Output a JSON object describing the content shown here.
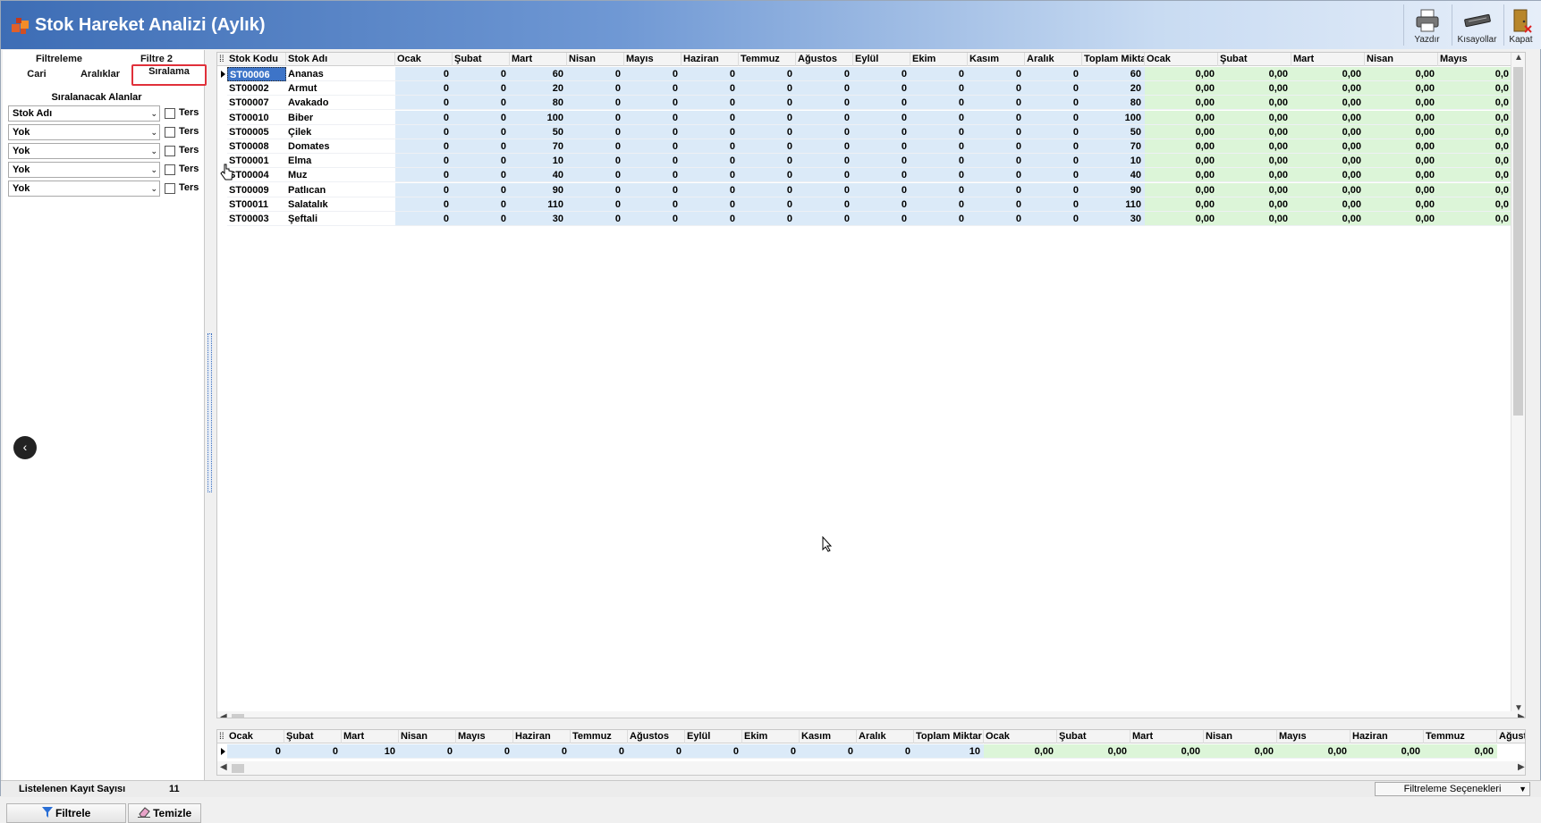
{
  "app": {
    "title": "Stok Hareket Analizi (Aylık)",
    "toolbar": {
      "print_label": "Yazdır",
      "shortcuts_label": "Kısayollar",
      "close_label": "Kapat"
    }
  },
  "left_panel": {
    "tabs_row1": [
      "Filtreleme",
      "Filtre 2"
    ],
    "tabs_row2": [
      "Cari",
      "Aralıklar",
      "Sıralama"
    ],
    "active_tab": "Sıralama",
    "section_title": "Sıralanacak Alanlar",
    "sort_fields": [
      {
        "value": "Stok Adı",
        "reverse_label": "Ters",
        "reverse": false
      },
      {
        "value": "Yok",
        "reverse_label": "Ters",
        "reverse": false
      },
      {
        "value": "Yok",
        "reverse_label": "Ters",
        "reverse": false
      },
      {
        "value": "Yok",
        "reverse_label": "Ters",
        "reverse": false
      },
      {
        "value": "Yok",
        "reverse_label": "Ters",
        "reverse": false
      }
    ],
    "filter_button": "Filtrele",
    "clear_button": "Temizle"
  },
  "grid": {
    "columns": [
      "Stok Kodu",
      "Stok Adı",
      "Ocak",
      "Şubat",
      "Mart",
      "Nisan",
      "Mayıs",
      "Haziran",
      "Temmuz",
      "Ağustos",
      "Eylül",
      "Ekim",
      "Kasım",
      "Aralık",
      "Toplam Miktar",
      "Ocak",
      "Şubat",
      "Mart",
      "Nisan",
      "Mayıs"
    ],
    "rows": [
      {
        "code": "ST00006",
        "name": "Ananas",
        "months": [
          "0",
          "0",
          "60",
          "0",
          "0",
          "0",
          "0",
          "0",
          "0",
          "0",
          "0",
          "0"
        ],
        "total": "60",
        "amounts": [
          "0,00",
          "0,00",
          "0,00",
          "0,00",
          "0,0"
        ]
      },
      {
        "code": "ST00002",
        "name": "Armut",
        "months": [
          "0",
          "0",
          "20",
          "0",
          "0",
          "0",
          "0",
          "0",
          "0",
          "0",
          "0",
          "0"
        ],
        "total": "20",
        "amounts": [
          "0,00",
          "0,00",
          "0,00",
          "0,00",
          "0,0"
        ]
      },
      {
        "code": "ST00007",
        "name": "Avakado",
        "months": [
          "0",
          "0",
          "80",
          "0",
          "0",
          "0",
          "0",
          "0",
          "0",
          "0",
          "0",
          "0"
        ],
        "total": "80",
        "amounts": [
          "0,00",
          "0,00",
          "0,00",
          "0,00",
          "0,0"
        ]
      },
      {
        "code": "ST00010",
        "name": "Biber",
        "months": [
          "0",
          "0",
          "100",
          "0",
          "0",
          "0",
          "0",
          "0",
          "0",
          "0",
          "0",
          "0"
        ],
        "total": "100",
        "amounts": [
          "0,00",
          "0,00",
          "0,00",
          "0,00",
          "0,0"
        ]
      },
      {
        "code": "ST00005",
        "name": "Çilek",
        "months": [
          "0",
          "0",
          "50",
          "0",
          "0",
          "0",
          "0",
          "0",
          "0",
          "0",
          "0",
          "0"
        ],
        "total": "50",
        "amounts": [
          "0,00",
          "0,00",
          "0,00",
          "0,00",
          "0,0"
        ]
      },
      {
        "code": "ST00008",
        "name": "Domates",
        "months": [
          "0",
          "0",
          "70",
          "0",
          "0",
          "0",
          "0",
          "0",
          "0",
          "0",
          "0",
          "0"
        ],
        "total": "70",
        "amounts": [
          "0,00",
          "0,00",
          "0,00",
          "0,00",
          "0,0"
        ]
      },
      {
        "code": "ST00001",
        "name": "Elma",
        "months": [
          "0",
          "0",
          "10",
          "0",
          "0",
          "0",
          "0",
          "0",
          "0",
          "0",
          "0",
          "0"
        ],
        "total": "10",
        "amounts": [
          "0,00",
          "0,00",
          "0,00",
          "0,00",
          "0,0"
        ]
      },
      {
        "code": "ST00004",
        "name": "Muz",
        "months": [
          "0",
          "0",
          "40",
          "0",
          "0",
          "0",
          "0",
          "0",
          "0",
          "0",
          "0",
          "0"
        ],
        "total": "40",
        "amounts": [
          "0,00",
          "0,00",
          "0,00",
          "0,00",
          "0,0"
        ]
      },
      {
        "code": "ST00009",
        "name": "Patlıcan",
        "months": [
          "0",
          "0",
          "90",
          "0",
          "0",
          "0",
          "0",
          "0",
          "0",
          "0",
          "0",
          "0"
        ],
        "total": "90",
        "amounts": [
          "0,00",
          "0,00",
          "0,00",
          "0,00",
          "0,0"
        ]
      },
      {
        "code": "ST00011",
        "name": "Salatalık",
        "months": [
          "0",
          "0",
          "110",
          "0",
          "0",
          "0",
          "0",
          "0",
          "0",
          "0",
          "0",
          "0"
        ],
        "total": "110",
        "amounts": [
          "0,00",
          "0,00",
          "0,00",
          "0,00",
          "0,0"
        ]
      },
      {
        "code": "ST00003",
        "name": "Şeftali",
        "months": [
          "0",
          "0",
          "30",
          "0",
          "0",
          "0",
          "0",
          "0",
          "0",
          "0",
          "0",
          "0"
        ],
        "total": "30",
        "amounts": [
          "0,00",
          "0,00",
          "0,00",
          "0,00",
          "0,0"
        ]
      }
    ]
  },
  "totals": {
    "columns": [
      "Ocak",
      "Şubat",
      "Mart",
      "Nisan",
      "Mayıs",
      "Haziran",
      "Temmuz",
      "Ağustos",
      "Eylül",
      "Ekim",
      "Kasım",
      "Aralık",
      "Toplam Miktar",
      "Ocak",
      "Şubat",
      "Mart",
      "Nisan",
      "Mayıs",
      "Haziran",
      "Temmuz",
      "Ağust"
    ],
    "months": [
      "0",
      "0",
      "10",
      "0",
      "0",
      "0",
      "0",
      "0",
      "0",
      "0",
      "0",
      "0"
    ],
    "total": "10",
    "amounts": [
      "0,00",
      "0,00",
      "0,00",
      "0,00",
      "0,00",
      "0,00",
      "0,00"
    ]
  },
  "status": {
    "record_count_label": "Listelenen Kayıt Sayısı",
    "record_count": "11",
    "filter_options_label": "Filtreleme Seçenekleri"
  },
  "colors": {
    "title_accent": "#3d6db5",
    "quantity_bg": "#dbeaf8",
    "amount_bg": "#dcf5d8",
    "tab_highlight": "#e0303a"
  }
}
